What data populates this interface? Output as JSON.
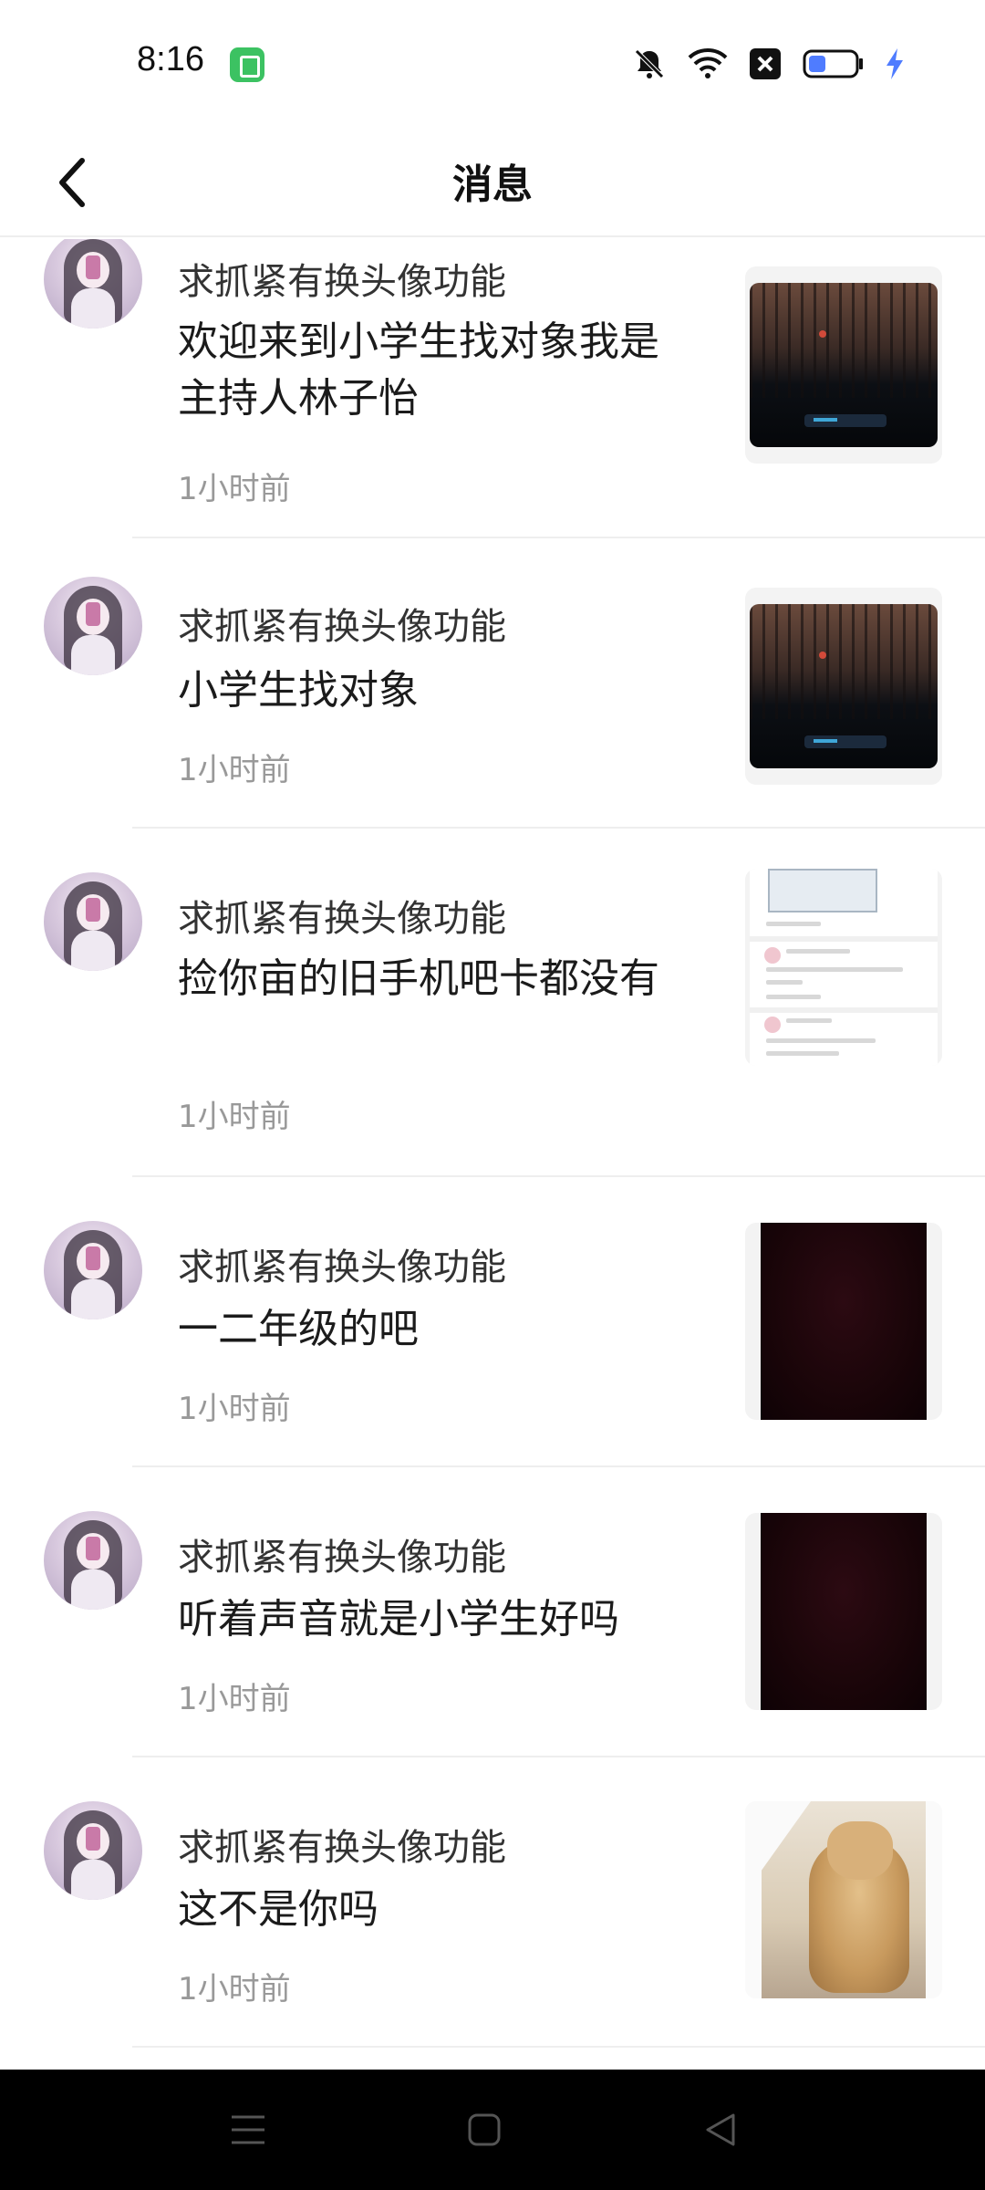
{
  "status_bar": {
    "time": "8:16",
    "icons": [
      "app-badge-icon",
      "bell-muted-icon",
      "wifi-icon",
      "sim-x-icon",
      "battery-icon",
      "charging-icon"
    ],
    "battery_color": "#4f7cff"
  },
  "header": {
    "title": "消息",
    "back_icon": "chevron-left-icon"
  },
  "messages": [
    {
      "sender": "求抓紧有换头像功能",
      "text": "欢迎来到小学生找对象我是主持人林子怡",
      "time": "1小时前",
      "thumbnail": "night-car-photo"
    },
    {
      "sender": "求抓紧有换头像功能",
      "text": "小学生找对象",
      "time": "1小时前",
      "thumbnail": "night-car-photo"
    },
    {
      "sender": "求抓紧有换头像功能",
      "text": "捡你亩的旧手机吧卡都没有",
      "time": "1小时前",
      "thumbnail": "chat-screenshot"
    },
    {
      "sender": "求抓紧有换头像功能",
      "text": "一二年级的吧",
      "time": "1小时前",
      "thumbnail": "dark-red-video"
    },
    {
      "sender": "求抓紧有换头像功能",
      "text": "听着声音就是小学生好吗",
      "time": "1小时前",
      "thumbnail": "dark-red-video"
    },
    {
      "sender": "求抓紧有换头像功能",
      "text": "这不是你吗",
      "time": "1小时前",
      "thumbnail": "dog-photo"
    }
  ],
  "nav_bar": {
    "icons": [
      "menu-icon",
      "home-square-icon",
      "back-triangle-icon"
    ]
  }
}
